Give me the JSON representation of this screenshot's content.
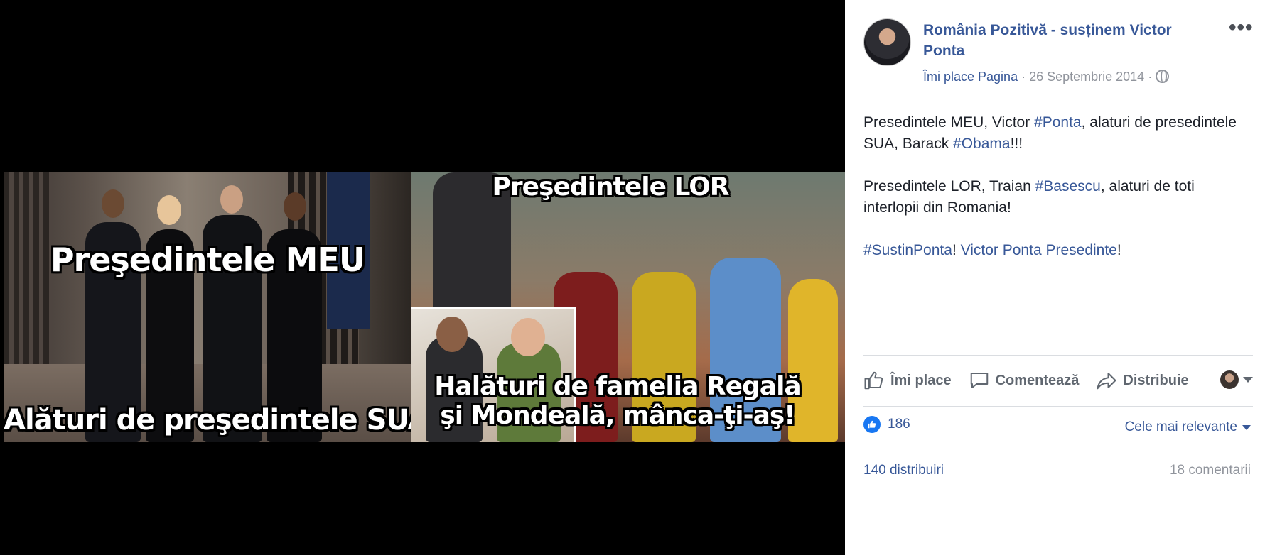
{
  "photo": {
    "left_caption_top": "Preşedintele MEU",
    "left_caption_bottom": "Alături de preşedintele SUA",
    "right_caption_top": "Preşedintele LOR",
    "right_caption_bottom_line1": "Halături de famelia Regală",
    "right_caption_bottom_line2": "şi Mondeală, mânca-ţi-aş!"
  },
  "post": {
    "page_name": "România Pozitivă - susținem Victor Ponta",
    "like_page": "Îmi place Pagina",
    "separator": " · ",
    "date": "26 Septembrie 2014",
    "more_icon": "•••",
    "paragraph1_a": "Presedintele MEU, Victor ",
    "paragraph1_tag1": "#Ponta",
    "paragraph1_b": ", alaturi de presedintele SUA, Barack ",
    "paragraph1_tag2": "#Obama",
    "paragraph1_c": "!!!",
    "paragraph2_a": "Presedintele LOR, Traian ",
    "paragraph2_tag": "#Basescu",
    "paragraph2_b": ", alaturi de toti interlopii din Romania!",
    "paragraph3_tag": "#SustinPonta",
    "paragraph3_a": "! ",
    "paragraph3_link": "Victor Ponta Presedinte",
    "paragraph3_b": "!"
  },
  "actions": {
    "like": "Îmi place",
    "comment": "Comentează",
    "share": "Distribuie"
  },
  "stats": {
    "reactions_count": "186",
    "sort_label": "Cele mai relevante",
    "shares": "140 distribuiri",
    "comments": "18 comentarii"
  },
  "colors": {
    "link": "#385898",
    "muted": "#90949c",
    "like_blue": "#1877f2"
  }
}
